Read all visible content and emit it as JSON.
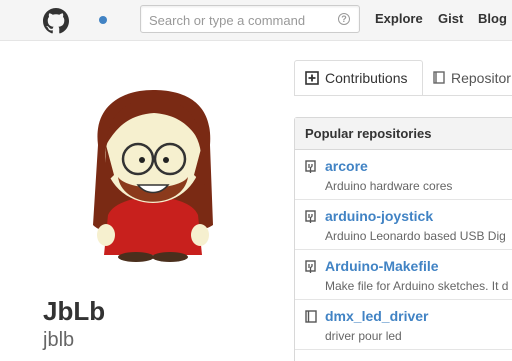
{
  "header": {
    "search": {
      "placeholder": "Search or type a command",
      "value": ""
    },
    "nav": [
      "Explore",
      "Gist",
      "Blog"
    ]
  },
  "profile": {
    "full_name": "JbLb",
    "username": "jblb"
  },
  "tabs": [
    {
      "label": "Contributions",
      "icon": "contributions-icon",
      "active": true
    },
    {
      "label": "Repositor",
      "icon": "repo-icon",
      "active": false
    }
  ],
  "popular": {
    "title": "Popular repositories",
    "repos": [
      {
        "name": "arcore",
        "description": "Arduino hardware cores",
        "icon": "repo-forked-icon"
      },
      {
        "name": "arduino-joystick",
        "description": "Arduino Leonardo based USB Dig",
        "icon": "repo-forked-icon"
      },
      {
        "name": "Arduino-Makefile",
        "description": "Make file for Arduino sketches. It d",
        "icon": "repo-forked-icon"
      },
      {
        "name": "dmx_led_driver",
        "description": "driver pour led",
        "icon": "repo-icon"
      }
    ]
  },
  "colors": {
    "link": "#4183c4",
    "notification": "#4183c4",
    "header_bg": "#f5f5f5"
  }
}
